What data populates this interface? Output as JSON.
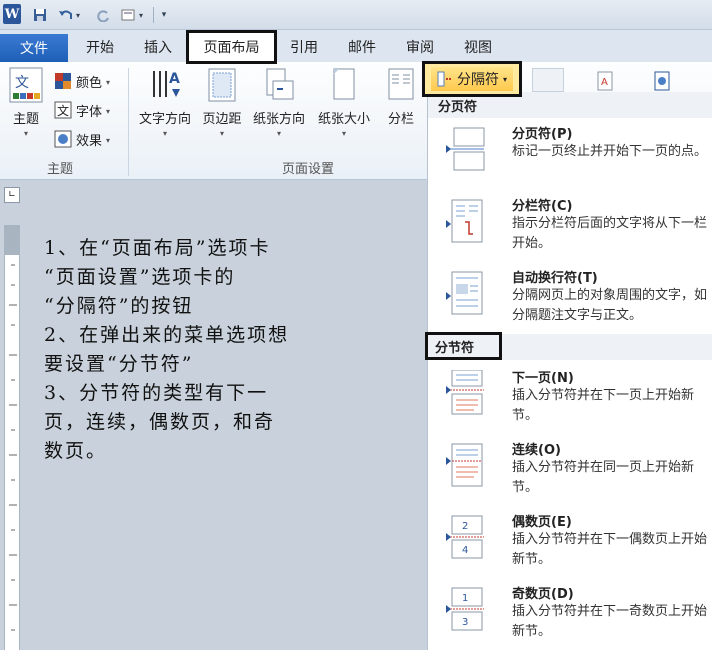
{
  "app": {
    "logo_letter": "W"
  },
  "quick_access": {
    "save_icon": "save-icon",
    "undo_icon": "undo-icon",
    "redo_icon": "redo-icon",
    "print_preview_icon": "print-preview-icon",
    "customize_icon": "customize-qat-icon"
  },
  "tabs": [
    {
      "label": "文件"
    },
    {
      "label": "开始"
    },
    {
      "label": "插入"
    },
    {
      "label": "页面布局"
    },
    {
      "label": "引用"
    },
    {
      "label": "邮件"
    },
    {
      "label": "审阅"
    },
    {
      "label": "视图"
    }
  ],
  "ribbon": {
    "theme_group": {
      "label": "主题",
      "theme_button": "主题",
      "colors": "颜色",
      "fonts": "字体",
      "effects": "效果"
    },
    "page_setup_group": {
      "label": "页面设置",
      "text_direction": "文字方向",
      "margins": "页边距",
      "orientation": "纸张方向",
      "size": "纸张大小",
      "columns": "分栏"
    },
    "breaks_button": "分隔符"
  },
  "document": {
    "lines": [
      "1、在“页面布局”选项卡",
      "“页面设置”选项卡的",
      "“分隔符”的按钮",
      "2、在弹出来的菜单选项想",
      "要设置“分节符”",
      "3、分节符的类型有下一",
      "页，连续，偶数页，和奇",
      "数页。"
    ]
  },
  "breaks_menu": {
    "page_breaks_header": "分页符",
    "section_breaks_header": "分节符",
    "page_break_items": [
      {
        "title": "分页符(P)",
        "desc": "标记一页终止并开始下一页的点。"
      },
      {
        "title": "分栏符(C)",
        "desc": "指示分栏符后面的文字将从下一栏开始。"
      },
      {
        "title": "自动换行符(T)",
        "desc": "分隔网页上的对象周围的文字，如分隔题注文字与正文。"
      }
    ],
    "section_break_items": [
      {
        "title": "下一页(N)",
        "desc": "插入分节符并在下一页上开始新节。"
      },
      {
        "title": "连续(O)",
        "desc": "插入分节符并在同一页上开始新节。"
      },
      {
        "title": "偶数页(E)",
        "desc": "插入分节符并在下一偶数页上开始新节。"
      },
      {
        "title": "奇数页(D)",
        "desc": "插入分节符并在下一奇数页上开始新节。"
      }
    ]
  },
  "colors": {
    "accent": "#2b579a",
    "highlight": "#ffc94d"
  }
}
